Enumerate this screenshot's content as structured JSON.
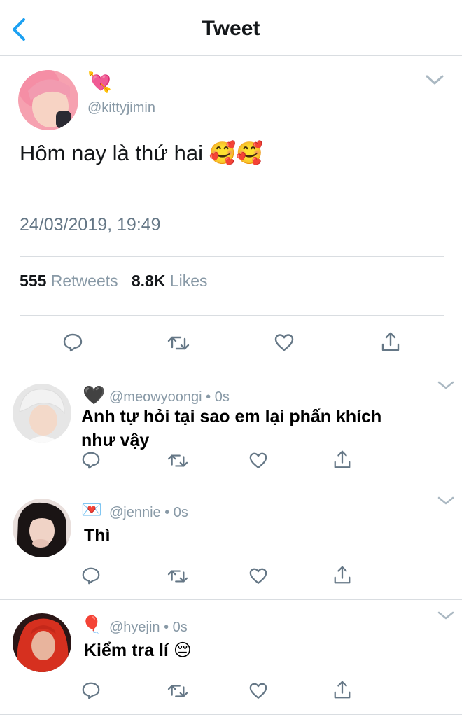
{
  "header": {
    "title": "Tweet"
  },
  "main_tweet": {
    "name_emoji": "💘",
    "handle": "@kittyjimin",
    "text": "Hôm nay là thứ hai 🥰🥰",
    "timestamp": "24/03/2019, 19:49",
    "retweets_count": "555",
    "retweets_label": "Retweets",
    "likes_count": "8.8K",
    "likes_label": "Likes"
  },
  "replies": [
    {
      "emoji": "🖤",
      "handle": "@meowyoongi • 0s",
      "text": "Anh tự hỏi tại sao em lại phấn khích như vậy"
    },
    {
      "emoji": "💌",
      "handle": "@jennie • 0s",
      "text": "Thì"
    },
    {
      "emoji": "🎈",
      "handle": "@hyejin • 0s",
      "text": "Kiểm tra lí 😔"
    }
  ],
  "colors": {
    "accent": "#1da1f2",
    "muted": "#8899a6",
    "divider": "#d9dde1",
    "icon": "#657786"
  }
}
